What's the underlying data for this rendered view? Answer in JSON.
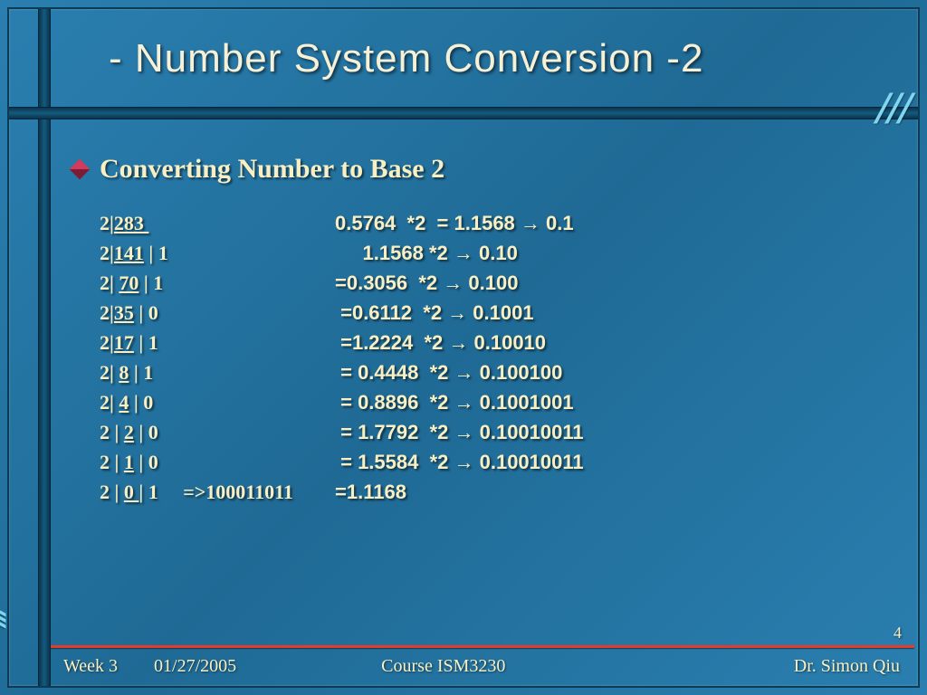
{
  "title": "- Number System Conversion -2",
  "heading": "Converting Number to Base 2",
  "rows": [
    {
      "left_pre": "2|",
      "left_num": "283 ",
      "left_post": "",
      "right": "0.5764  *2  = 1.1568 → 0.1"
    },
    {
      "left_pre": "2|",
      "left_num": "141",
      "left_post": " | 1",
      "right": "     1.1568 *2 → 0.10"
    },
    {
      "left_pre": "2| ",
      "left_num": "70",
      "left_post": " | 1",
      "right": "=0.3056  *2 → 0.100"
    },
    {
      "left_pre": "2|",
      "left_num": "35",
      "left_post": " | 0",
      "right": " =0.6112  *2 → 0.1001"
    },
    {
      "left_pre": "2|",
      "left_num": "17",
      "left_post": " | 1",
      "right": " =1.2224  *2 → 0.10010"
    },
    {
      "left_pre": "2| ",
      "left_num": "8",
      "left_post": " | 1",
      "right": " = 0.4448  *2 → 0.100100"
    },
    {
      "left_pre": "2| ",
      "left_num": "4",
      "left_post": " | 0",
      "right": " = 0.8896  *2 → 0.1001001"
    },
    {
      "left_pre": "2 | ",
      "left_num": "2",
      "left_post": " | 0",
      "right": " = 1.7792  *2 → 0.10010011"
    },
    {
      "left_pre": "2 | ",
      "left_num": "1",
      "left_post": " | 0",
      "right": " = 1.5584  *2 → 0.10010011"
    },
    {
      "left_pre": "2 | ",
      "left_num": "0 ",
      "left_post": "| 1     =>100011011",
      "right": "=1.1168"
    }
  ],
  "footer": {
    "week": "Week 3",
    "date": "01/27/2005",
    "course": "Course ISM3230",
    "instructor": "Dr. Simon Qiu"
  },
  "page": "4",
  "deco": {
    "top_stripes": "///",
    "bottom_stripes": "///"
  }
}
